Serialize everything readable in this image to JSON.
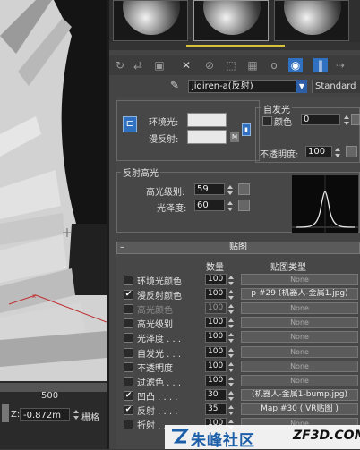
{
  "viewport": {
    "ruler_value": "500",
    "coord_axis": "Z:",
    "coord_value": "-0.872m",
    "grid_label": "栅格"
  },
  "material": {
    "name": "jiqiren-a(反射)",
    "type": "Standard"
  },
  "basic": {
    "ambient_label": "环境光:",
    "diffuse_label": "漫反射:",
    "m_label": "M",
    "self_illum_title": "自发光",
    "color_label": "颜色",
    "color_value": "0",
    "opacity_label": "不透明度:",
    "opacity_value": "100",
    "specular_title": "反射高光",
    "spec_level_label": "高光级别:",
    "spec_level_value": "59",
    "gloss_label": "光泽度:",
    "gloss_value": "60"
  },
  "maps": {
    "title": "贴图",
    "col_amount": "数量",
    "col_type": "贴图类型",
    "rows": [
      {
        "name": "环境光颜色",
        "checked": false,
        "dim": false,
        "amount": "100",
        "map": "None"
      },
      {
        "name": "漫反射颜色",
        "checked": true,
        "dim": false,
        "amount": "100",
        "map": "p #29 (机器人-金属1.jpg)"
      },
      {
        "name": "高光颜色",
        "checked": false,
        "dim": true,
        "amount": "100",
        "map": "None"
      },
      {
        "name": "高光级别",
        "checked": false,
        "dim": false,
        "amount": "100",
        "map": "None"
      },
      {
        "name": "光泽度 . . .",
        "checked": false,
        "dim": false,
        "amount": "100",
        "map": "None"
      },
      {
        "name": "自发光 . . .",
        "checked": false,
        "dim": false,
        "amount": "100",
        "map": "None"
      },
      {
        "name": "不透明度",
        "checked": false,
        "dim": false,
        "amount": "100",
        "map": "None"
      },
      {
        "name": "过滤色 . . .",
        "checked": false,
        "dim": false,
        "amount": "100",
        "map": "None"
      },
      {
        "name": "凹凸 . . . .",
        "checked": true,
        "dim": false,
        "amount": "30",
        "map": "(机器人-金属1-bump.jpg)"
      },
      {
        "name": "反射 . . . .",
        "checked": true,
        "dim": false,
        "amount": "35",
        "map": "Map #30  ( VR贴图 )"
      },
      {
        "name": "折射 . . . .",
        "checked": false,
        "dim": false,
        "amount": "100",
        "map": "None"
      }
    ]
  },
  "watermark": {
    "site_name": "朱峰社区",
    "url": "ZF3D.COM"
  },
  "colors": {
    "accent_blue": "#2f70c0",
    "yellow_line": "#d8c23a",
    "panel_bg": "#444444"
  }
}
